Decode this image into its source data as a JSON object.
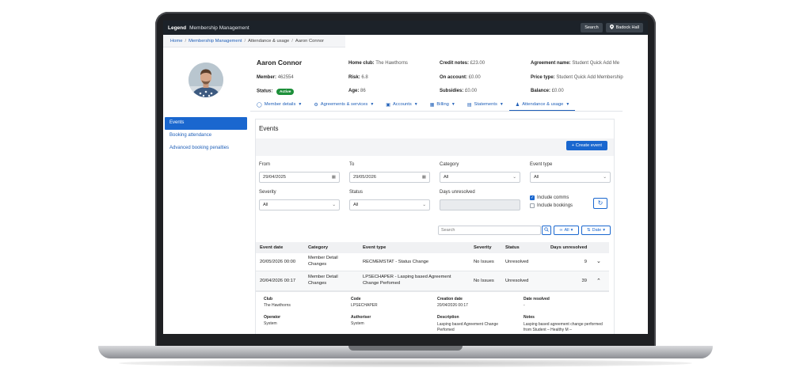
{
  "topbar": {
    "brand": "Legend",
    "title": "Membership Management",
    "search_label": "Search",
    "location_label": "Badock Hall"
  },
  "breadcrumb": {
    "home": "Home",
    "section": "Membership Management",
    "page": "Attendance & usage",
    "member": "Aaron Connor"
  },
  "member": {
    "name": "Aaron Connor",
    "member_label": "Member:",
    "member_value": "462554",
    "status_label": "Status:",
    "status_value": "Active",
    "home_club_label": "Home club:",
    "home_club_value": "The Hawthorns",
    "risk_label": "Risk:",
    "risk_value": "6.8",
    "age_label": "Age:",
    "age_value": "86",
    "credit_label": "Credit notes:",
    "credit_value": "£23.00",
    "account_label": "On account:",
    "account_value": "£0.00",
    "subsidies_label": "Subsidies:",
    "subsidies_value": "£0.00",
    "agreement_label": "Agreement name:",
    "agreement_value": "Student Quick Add Me",
    "price_label": "Price type:",
    "price_value": "Student Quick Add Membership",
    "balance_label": "Balance:",
    "balance_value": "£0.00"
  },
  "tabs": [
    {
      "label": "Member details",
      "icon": "user-icon"
    },
    {
      "label": "Agreements & services",
      "icon": "sliders-icon"
    },
    {
      "label": "Accounts",
      "icon": "book-icon"
    },
    {
      "label": "Billing",
      "icon": "card-icon"
    },
    {
      "label": "Statements",
      "icon": "document-icon"
    },
    {
      "label": "Attendance & usage",
      "icon": "person-icon"
    }
  ],
  "sidebar": {
    "items": [
      "Events",
      "Booking attendance",
      "Advanced booking penalties"
    ]
  },
  "events": {
    "title": "Events",
    "create_label": "Create event",
    "from_label": "From",
    "from_value": "29/04/2025",
    "to_label": "To",
    "to_value": "29/05/2026",
    "category_label": "Category",
    "category_value": "All",
    "event_type_label": "Event type",
    "event_type_value": "All",
    "severity_label": "Severity",
    "severity_value": "All",
    "status_label": "Status",
    "status_value": "All",
    "days_label": "Days unresolved",
    "include_comms": "Include comms",
    "include_bookings": "Include bookings",
    "search_placeholder": "Search",
    "filter_all": "All",
    "sort_label": "Date"
  },
  "table": {
    "headers": [
      "Event date",
      "Category",
      "Event type",
      "Severity",
      "Status",
      "Days unresolved"
    ],
    "rows": [
      {
        "date": "20/05/2026 00:00",
        "category": "Member Detail Changes",
        "type": "RECMEMSTAT - Status Change",
        "severity": "No Issues",
        "status": "Unresolved",
        "days": "9"
      },
      {
        "date": "20/04/2026 00:17",
        "category": "Member Detail Changes",
        "type": "LPSECHAPER - Lasping based Agreement Change Perfomed",
        "severity": "No Issues",
        "status": "Unresolved",
        "days": "39"
      }
    ]
  },
  "detail": {
    "club_label": "Club",
    "club_value": "The Hawthorns",
    "code_label": "Code",
    "code_value": "LPSECHAPER",
    "created_label": "Creation date",
    "created_value": "20/04/2026 00:17",
    "resolved_label": "Date resolved",
    "resolved_value": "-",
    "operator_label": "Operator",
    "operator_value": "System",
    "authoriser_label": "Authoriser",
    "authoriser_value": "System",
    "description_label": "Description",
    "description_value": "Lasping based Agreement Change Perfomed",
    "notes_label": "Notes",
    "notes_value": "Lasping based agreement change performed from Student – Healthy M –"
  }
}
